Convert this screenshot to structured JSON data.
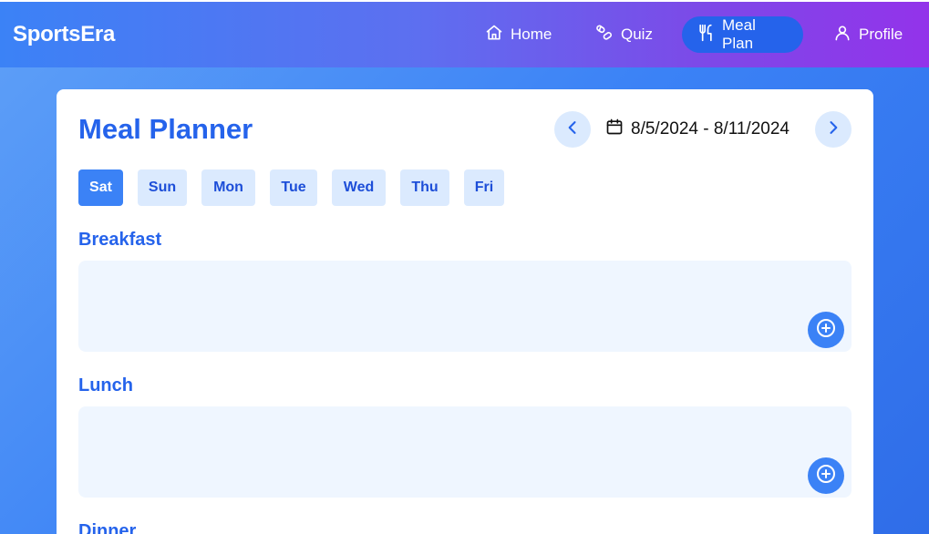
{
  "brand": "SportsEra",
  "nav": {
    "items": [
      {
        "label": "Home",
        "icon": "home-icon"
      },
      {
        "label": "Quiz",
        "icon": "pills-icon"
      },
      {
        "label": "Meal Plan",
        "icon": "utensils-icon",
        "active": true
      },
      {
        "label": "Profile",
        "icon": "user-icon"
      }
    ]
  },
  "planner": {
    "title": "Meal Planner",
    "date_range": "8/5/2024 - 8/11/2024",
    "days": [
      "Sat",
      "Sun",
      "Mon",
      "Tue",
      "Wed",
      "Thu",
      "Fri"
    ],
    "selected_day": "Sat",
    "meals": [
      {
        "label": "Breakfast"
      },
      {
        "label": "Lunch"
      },
      {
        "label": "Dinner"
      }
    ]
  },
  "colors": {
    "accent": "#2563eb",
    "active_tab": "#3b82f6",
    "tab_bg": "#dbeafe",
    "meal_box_bg": "#eff6ff",
    "nav_gradient_start": "#3b82f6",
    "nav_gradient_end": "#9333ea"
  }
}
